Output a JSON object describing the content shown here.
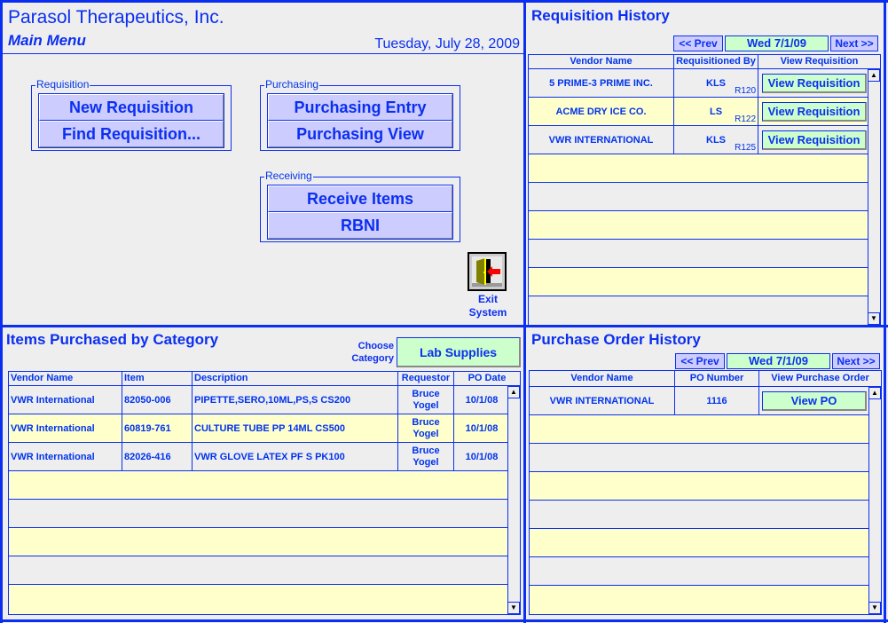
{
  "header": {
    "company": "Parasol Therapeutics, Inc.",
    "subtitle": "Main Menu",
    "date": "Tuesday, July 28, 2009"
  },
  "menu_groups": {
    "requisition": {
      "label": "Requisition",
      "buttons": [
        "New Requisition",
        "Find Requisition..."
      ]
    },
    "purchasing": {
      "label": "Purchasing",
      "buttons": [
        "Purchasing Entry",
        "Purchasing View"
      ]
    },
    "receiving": {
      "label": "Receiving",
      "buttons": [
        "Receive Items",
        "RBNI"
      ]
    }
  },
  "exit": {
    "label_line1": "Exit",
    "label_line2": "System",
    "icon": "exit-door-icon"
  },
  "requisition_history": {
    "title": "Requisition History",
    "prev_label": "<< Prev",
    "next_label": "Next >>",
    "date": "Wed 7/1/09",
    "columns": [
      "Vendor Name",
      "Requisitioned By",
      "View Requisition"
    ],
    "rows": [
      {
        "vendor": "5 PRIME-3 PRIME INC.",
        "by": "KLS",
        "code": "R120",
        "action": "View Requisition"
      },
      {
        "vendor": "ACME DRY ICE CO.",
        "by": "LS",
        "code": "R122",
        "action": "View Requisition"
      },
      {
        "vendor": "VWR INTERNATIONAL",
        "by": "KLS",
        "code": "R125",
        "action": "View Requisition"
      }
    ]
  },
  "items_by_category": {
    "title": "Items Purchased by Category",
    "choose_label_line1": "Choose",
    "choose_label_line2": "Category",
    "category": "Lab Supplies",
    "columns": [
      "Vendor Name",
      "Item",
      "Description",
      "Requestor",
      "PO Date"
    ],
    "rows": [
      {
        "vendor": "VWR International",
        "item": "82050-006",
        "description": "PIPETTE,SERO,10ML,PS,S CS200",
        "requestor_first": "Bruce",
        "requestor_last": "Yogel",
        "po_date": "10/1/08"
      },
      {
        "vendor": "VWR International",
        "item": "60819-761",
        "description": "CULTURE TUBE PP 14ML CS500",
        "requestor_first": "Bruce",
        "requestor_last": "Yogel",
        "po_date": "10/1/08"
      },
      {
        "vendor": "VWR International",
        "item": "82026-416",
        "description": "VWR GLOVE LATEX PF S PK100",
        "requestor_first": "Bruce",
        "requestor_last": "Yogel",
        "po_date": "10/1/08"
      }
    ]
  },
  "po_history": {
    "title": "Purchase Order History",
    "prev_label": "<< Prev",
    "next_label": "Next >>",
    "date": "Wed 7/1/09",
    "columns": [
      "Vendor Name",
      "PO Number",
      "View Purchase Order"
    ],
    "rows": [
      {
        "vendor": "VWR INTERNATIONAL",
        "po_number": "1116",
        "action": "View PO"
      }
    ]
  },
  "scroll": {
    "up": "▲",
    "down": "▼"
  }
}
